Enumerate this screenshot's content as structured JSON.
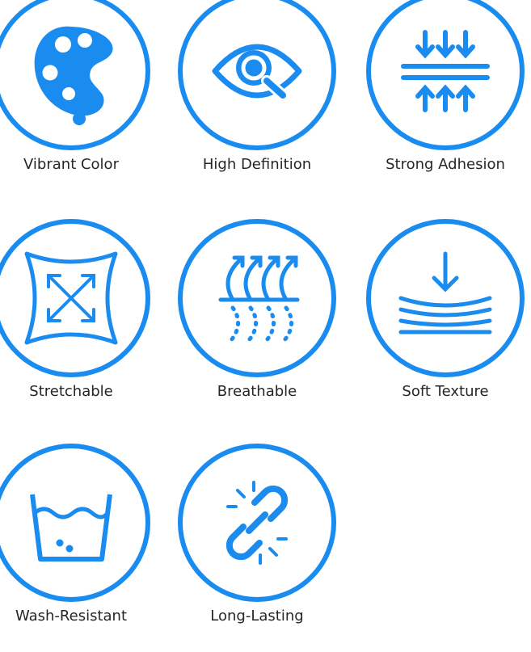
{
  "accent_color": "#1a8cf0",
  "features": [
    {
      "icon": "palette-icon",
      "label": "Vibrant Color"
    },
    {
      "icon": "eye-magnifier-icon",
      "label": "High Definition"
    },
    {
      "icon": "compression-arrows-icon",
      "label": "Strong Adhesion"
    },
    {
      "icon": "stretch-arrows-icon",
      "label": "Stretchable"
    },
    {
      "icon": "airflow-icon",
      "label": "Breathable"
    },
    {
      "icon": "soft-layers-icon",
      "label": "Soft Texture"
    },
    {
      "icon": "wash-basin-icon",
      "label": "Wash-Resistant"
    },
    {
      "icon": "chain-link-icon",
      "label": "Long-Lasting"
    }
  ]
}
